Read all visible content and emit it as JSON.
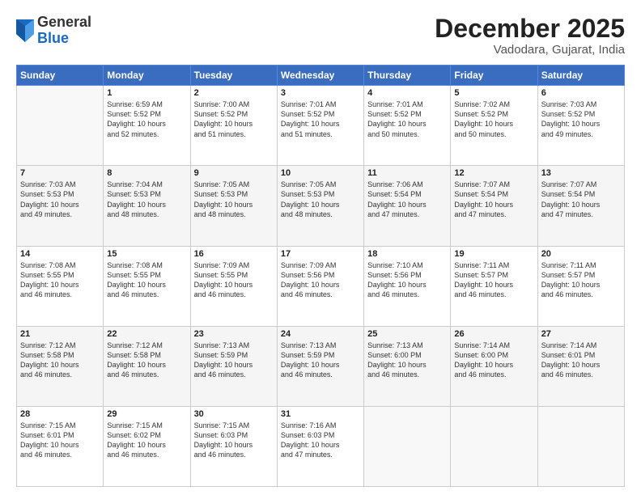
{
  "logo": {
    "general": "General",
    "blue": "Blue"
  },
  "header": {
    "month": "December 2025",
    "location": "Vadodara, Gujarat, India"
  },
  "weekdays": [
    "Sunday",
    "Monday",
    "Tuesday",
    "Wednesday",
    "Thursday",
    "Friday",
    "Saturday"
  ],
  "weeks": [
    [
      {
        "day": "",
        "info": ""
      },
      {
        "day": "1",
        "info": "Sunrise: 6:59 AM\nSunset: 5:52 PM\nDaylight: 10 hours\nand 52 minutes."
      },
      {
        "day": "2",
        "info": "Sunrise: 7:00 AM\nSunset: 5:52 PM\nDaylight: 10 hours\nand 51 minutes."
      },
      {
        "day": "3",
        "info": "Sunrise: 7:01 AM\nSunset: 5:52 PM\nDaylight: 10 hours\nand 51 minutes."
      },
      {
        "day": "4",
        "info": "Sunrise: 7:01 AM\nSunset: 5:52 PM\nDaylight: 10 hours\nand 50 minutes."
      },
      {
        "day": "5",
        "info": "Sunrise: 7:02 AM\nSunset: 5:52 PM\nDaylight: 10 hours\nand 50 minutes."
      },
      {
        "day": "6",
        "info": "Sunrise: 7:03 AM\nSunset: 5:52 PM\nDaylight: 10 hours\nand 49 minutes."
      }
    ],
    [
      {
        "day": "7",
        "info": "Sunrise: 7:03 AM\nSunset: 5:53 PM\nDaylight: 10 hours\nand 49 minutes."
      },
      {
        "day": "8",
        "info": "Sunrise: 7:04 AM\nSunset: 5:53 PM\nDaylight: 10 hours\nand 48 minutes."
      },
      {
        "day": "9",
        "info": "Sunrise: 7:05 AM\nSunset: 5:53 PM\nDaylight: 10 hours\nand 48 minutes."
      },
      {
        "day": "10",
        "info": "Sunrise: 7:05 AM\nSunset: 5:53 PM\nDaylight: 10 hours\nand 48 minutes."
      },
      {
        "day": "11",
        "info": "Sunrise: 7:06 AM\nSunset: 5:54 PM\nDaylight: 10 hours\nand 47 minutes."
      },
      {
        "day": "12",
        "info": "Sunrise: 7:07 AM\nSunset: 5:54 PM\nDaylight: 10 hours\nand 47 minutes."
      },
      {
        "day": "13",
        "info": "Sunrise: 7:07 AM\nSunset: 5:54 PM\nDaylight: 10 hours\nand 47 minutes."
      }
    ],
    [
      {
        "day": "14",
        "info": "Sunrise: 7:08 AM\nSunset: 5:55 PM\nDaylight: 10 hours\nand 46 minutes."
      },
      {
        "day": "15",
        "info": "Sunrise: 7:08 AM\nSunset: 5:55 PM\nDaylight: 10 hours\nand 46 minutes."
      },
      {
        "day": "16",
        "info": "Sunrise: 7:09 AM\nSunset: 5:55 PM\nDaylight: 10 hours\nand 46 minutes."
      },
      {
        "day": "17",
        "info": "Sunrise: 7:09 AM\nSunset: 5:56 PM\nDaylight: 10 hours\nand 46 minutes."
      },
      {
        "day": "18",
        "info": "Sunrise: 7:10 AM\nSunset: 5:56 PM\nDaylight: 10 hours\nand 46 minutes."
      },
      {
        "day": "19",
        "info": "Sunrise: 7:11 AM\nSunset: 5:57 PM\nDaylight: 10 hours\nand 46 minutes."
      },
      {
        "day": "20",
        "info": "Sunrise: 7:11 AM\nSunset: 5:57 PM\nDaylight: 10 hours\nand 46 minutes."
      }
    ],
    [
      {
        "day": "21",
        "info": "Sunrise: 7:12 AM\nSunset: 5:58 PM\nDaylight: 10 hours\nand 46 minutes."
      },
      {
        "day": "22",
        "info": "Sunrise: 7:12 AM\nSunset: 5:58 PM\nDaylight: 10 hours\nand 46 minutes."
      },
      {
        "day": "23",
        "info": "Sunrise: 7:13 AM\nSunset: 5:59 PM\nDaylight: 10 hours\nand 46 minutes."
      },
      {
        "day": "24",
        "info": "Sunrise: 7:13 AM\nSunset: 5:59 PM\nDaylight: 10 hours\nand 46 minutes."
      },
      {
        "day": "25",
        "info": "Sunrise: 7:13 AM\nSunset: 6:00 PM\nDaylight: 10 hours\nand 46 minutes."
      },
      {
        "day": "26",
        "info": "Sunrise: 7:14 AM\nSunset: 6:00 PM\nDaylight: 10 hours\nand 46 minutes."
      },
      {
        "day": "27",
        "info": "Sunrise: 7:14 AM\nSunset: 6:01 PM\nDaylight: 10 hours\nand 46 minutes."
      }
    ],
    [
      {
        "day": "28",
        "info": "Sunrise: 7:15 AM\nSunset: 6:01 PM\nDaylight: 10 hours\nand 46 minutes."
      },
      {
        "day": "29",
        "info": "Sunrise: 7:15 AM\nSunset: 6:02 PM\nDaylight: 10 hours\nand 46 minutes."
      },
      {
        "day": "30",
        "info": "Sunrise: 7:15 AM\nSunset: 6:03 PM\nDaylight: 10 hours\nand 46 minutes."
      },
      {
        "day": "31",
        "info": "Sunrise: 7:16 AM\nSunset: 6:03 PM\nDaylight: 10 hours\nand 47 minutes."
      },
      {
        "day": "",
        "info": ""
      },
      {
        "day": "",
        "info": ""
      },
      {
        "day": "",
        "info": ""
      }
    ]
  ]
}
